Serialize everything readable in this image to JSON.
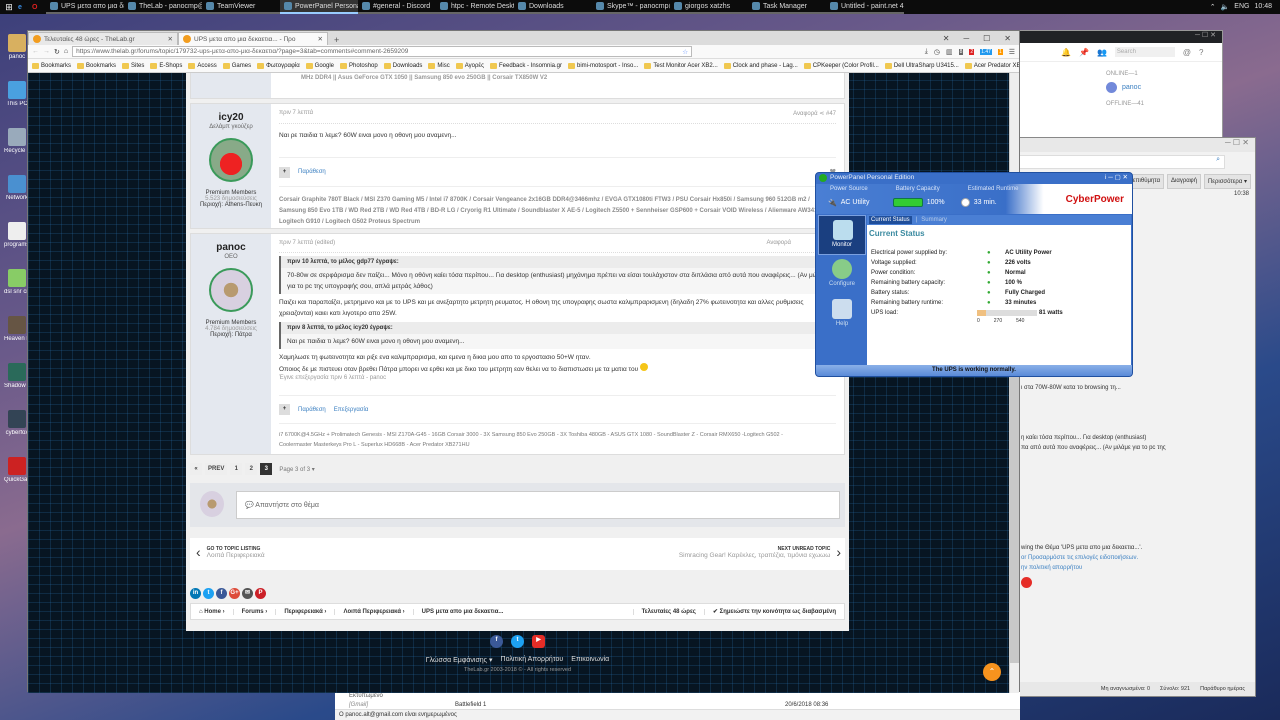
{
  "taskbar": {
    "items": [
      {
        "label": "UPS μετα απο μια δεκα...",
        "active": false
      },
      {
        "label": "TheLab - panocmp@...",
        "active": false
      },
      {
        "label": "TeamViewer",
        "active": false
      },
      {
        "label": "PowerPanel Personal ...",
        "active": true
      },
      {
        "label": "#general - Discord",
        "active": false
      },
      {
        "label": "htpc - Remote Deskto...",
        "active": false
      },
      {
        "label": "Downloads",
        "active": false
      },
      {
        "label": "Skype™ - panocmp@...",
        "active": false
      },
      {
        "label": "giorgos xatzhs",
        "active": false
      },
      {
        "label": "Task Manager",
        "active": false
      },
      {
        "label": "Untitled - paint.net 4....",
        "active": false
      }
    ],
    "language": "ENG",
    "clock": "10:48"
  },
  "desktop": {
    "icons": [
      "panoc",
      "This PC",
      "Recycle Bin",
      "Network",
      "programs...",
      "dsl snr cro",
      "Heaven Benchmark",
      "Shadow Returns",
      "cyberfox",
      "QuickGame"
    ]
  },
  "browser": {
    "tabs": [
      {
        "label": "Τελευταίες 48 ώρες - TheLab.gr"
      },
      {
        "label": "UPS μετα απο μια δεκαετια... - Προ"
      }
    ],
    "url": "https://www.thelab.gr/forums/topic/179732-ups-μετα-απο-μια-δεκαετια/?page=3&tab=comments#comment-2659209",
    "bookmarks": [
      "Bookmarks",
      "Bookmarks",
      "Sites",
      "E-Shops",
      "Access",
      "Games",
      "Φωτογραφία",
      "Google",
      "Photoshop",
      "Downloads",
      "Misc",
      "Αγορές",
      "Feedback - Insomnia.gr",
      "bimi-motosport - Inso...",
      "Test Monitor Acer XB2...",
      "Clock and phase - Lag...",
      "CPKeeper (Color Profil...",
      "Dell UltraSharp U3415...",
      "Acer Predator XB271H..."
    ],
    "badges": [
      "8",
      "2",
      "1.47",
      "1"
    ]
  },
  "forum": {
    "prev_sig": "MHz DDR4 || Asus GeForce GTX 1050 || Samsung 850 evo 250GB || Corsair TX850W V2",
    "posts": [
      {
        "author": "icy20",
        "rank": "Δελάμπ γκούζερ",
        "group": "Premium Members",
        "post_count": "5.523 δημοσιεύσεις",
        "location": "Περιοχή: Athens-Πευκη",
        "time": "πριν 7 λεπτά",
        "report": "Αναφορά",
        "number": "#47",
        "text": "Ναι ρε παιδια τι λεμε? 60W ειναι μονο η οθονη μου αναμενη...",
        "quote_label": "Παράθεση",
        "signature": "Corsair Graphite 780T Black / MSI Z370 Gaming M5 / Intel i7 8700K / Corsair Vengeance 2x16GB DDR4@3466mhz / EVGA GTX1080ti FTW3 / PSU Corsair Hx850i / Samsung 960 512GB m2 / Samsung 850 Evo 1TB / WD Red 2TB / WD Red 4TB / BD-R LG / Cryorig R1 Ultimate / Soundblaster X AE-5 / Logitech Z5500 + Sennheiser GSP600 + Corsair VOID Wireless / Alienware AW3418DW / Logitech G910 / Logitech G502 Proteus Spectrum"
      },
      {
        "author": "panoc",
        "rank": "OEO",
        "group": "Premium Members",
        "post_count": "4.784 δημοσιεύσεις",
        "location": "Περιοχή: Πάτρα",
        "time": "πριν 7 λεπτά (edited)",
        "report": "Αναφορά",
        "quote1_header": "πριν 10 λεπτά, το μέλος gdp77 έγραψε:",
        "quote1_body": "70-80w σε σερφάρισμα δεν παίζει... Μόνο η οθόνη καίει τόσα περίπου... Για desktop (enthusiast) μηχάνημα πρέπει να είσαι τουλάχιστον στα διπλάσια από αυτά που αναφέρεις... (Αν μιλάμε για το pc της υπογραφής σου, απλά μετράς λάθος)",
        "text1": "Παιζει και παραπαίζει, μετρημενο και με το UPS και με ανεξαρτητο μετρητη ρευματος. Η οθονη της υπογραφης σωστα καλιμπραρισμενη (δηλαδη 27% φωτεινοτητα και αλλες ρυθμισεις χρειαζονται) καιει κατι λιγοτερο απο 25W.",
        "quote2_header": "πριν 8 λεπτά, το μέλος icy20 έγραψε:",
        "quote2_body": "Ναι ρε παιδια τι λεμε? 60W ειναι μονο η οθονη μου αναμενη...",
        "text2": "Χαμηλωσε τη φωτεινοτητα και ριξε ενα καλιμπραρισμα, και εμενα η δικια μου απο το εργοστασιο 50+W ηταν.",
        "text3": "Οποιος δε με πιστευει οταν βρεθει Πάτρα μπορει να ερθει και με δικο του μετρητη εαν θελει να το διαπιστωσει με τα ματια του",
        "edited": "Έγινε επεξεργασία πριν 6 λεπτά - panoc",
        "quote_label": "Παράθεση",
        "edit_label": "Επεξεργασία",
        "signature": "i7 6700K@4.5GHz + Prolimatech Genesis - MSI Z170A-G45 - 16GB Corsair 3000 - 3X Samsung 850 Evo 250GB - 3X Toshiba 480GB - ASUS GTX 1080 - SoundBlaster Z - Corsair RMX650 -Logitech G502 - Coolermaster Masterkeys Pro L - Superlux HD668B - Acer Predator XB271HU"
      }
    ],
    "pager": {
      "first": "«",
      "prev": "PREV",
      "pages": [
        "1",
        "2",
        "3"
      ],
      "current": "3",
      "label": "Page 3 of 3 ▾"
    },
    "reply_placeholder": "💬 Απαντήστε στο θέμα",
    "nav": {
      "back_label": "GO TO TOPIC LISTING",
      "back_sub": "Λοιπά Περιφερειακά",
      "next_label": "NEXT UNREAD TOPIC",
      "next_sub": "Simracing Gear! Καρέκλες, τραπέζια, τιμόνια εχωωω"
    },
    "share": [
      "in",
      "t",
      "f",
      "G+",
      "✉",
      "P"
    ],
    "breadcrumbs": [
      "⌂ Home ›",
      "Forums ›",
      "Περιφερειακά ›",
      "Λοιπά Περιφερειακά ›",
      "UPS μετα απο μια δεκαετια..."
    ],
    "last48": "Τελευταίες 48 ώρες",
    "mark_read": "✔ Σημειώστε την κοινότητα ως διαβασμένη",
    "footer": {
      "links": [
        "Γλώσσα Εμφάνισης ▾",
        "Πολιτική Απορρήτου",
        "Επικοινωνία"
      ],
      "copyright": "TheLab.gr 2003-2018 © - All rights reserved"
    }
  },
  "discord": {
    "search": "Search",
    "online": "ONLINE—1",
    "user": "panoc",
    "offline": "OFFLINE—41"
  },
  "mail": {
    "buttons": [
      "Ανεπιθύμητα",
      "Διαγραφή",
      "Περισσότερα ▾"
    ],
    "time": "10:38",
    "snippets": [
      "ι στα 70W-80W κατα το browsing τη...",
      "η καίει τόσα περίπου... Για desktop (enthusiast)",
      "πα από αυτά που αναφέρεις... (Αν μιλάμε για το pc της",
      "wing the Θέμα 'UPS μετα απο μια δεκαετια...'.",
      "or Προσαρμόστε τις επιλογές ειδοποιήσεων.",
      "ην πολιτική απορρήτου"
    ],
    "folders": [
      "Εκτυπωμένο",
      "[Gmail]"
    ],
    "row_subject": "Battlefield 1",
    "row_date": "20/6/2018 08:36",
    "status": "Ο panoc.alt@gmail.com είναι ενημερωμένος",
    "unread": "Μη αναγνωσμένα: 0",
    "total": "Σύνολο: 921",
    "today": "Παράθυρο ημέρας"
  },
  "powerpanel": {
    "title": "PowerPanel Personal Edition",
    "brand": "CyberPower",
    "header": {
      "power_source_label": "Power Source",
      "power_source": "AC Utility",
      "battery_label": "Battery Capacity",
      "battery": "100%",
      "runtime_label": "Estimated Runtime",
      "runtime": "33 min."
    },
    "nav": [
      "Monitor",
      "Configure",
      "Help"
    ],
    "tabs": [
      "Current Status",
      "Summary"
    ],
    "heading": "Current Status",
    "rows": [
      {
        "k": "Electrical power supplied by:",
        "v": "AC Utility Power"
      },
      {
        "k": "Voltage supplied:",
        "v": "226 volts"
      },
      {
        "k": "Power condition:",
        "v": "Normal"
      },
      {
        "k": "Remaining battery capacity:",
        "v": "100 %"
      },
      {
        "k": "Battery status:",
        "v": "Fully Charged"
      },
      {
        "k": "Remaining battery runtime:",
        "v": "33 minutes"
      },
      {
        "k": "UPS load:",
        "v": "81 watts"
      }
    ],
    "load_fraction": 0.15,
    "load_ticks": [
      "0",
      "270",
      "540"
    ],
    "status": "The UPS is working normally."
  }
}
